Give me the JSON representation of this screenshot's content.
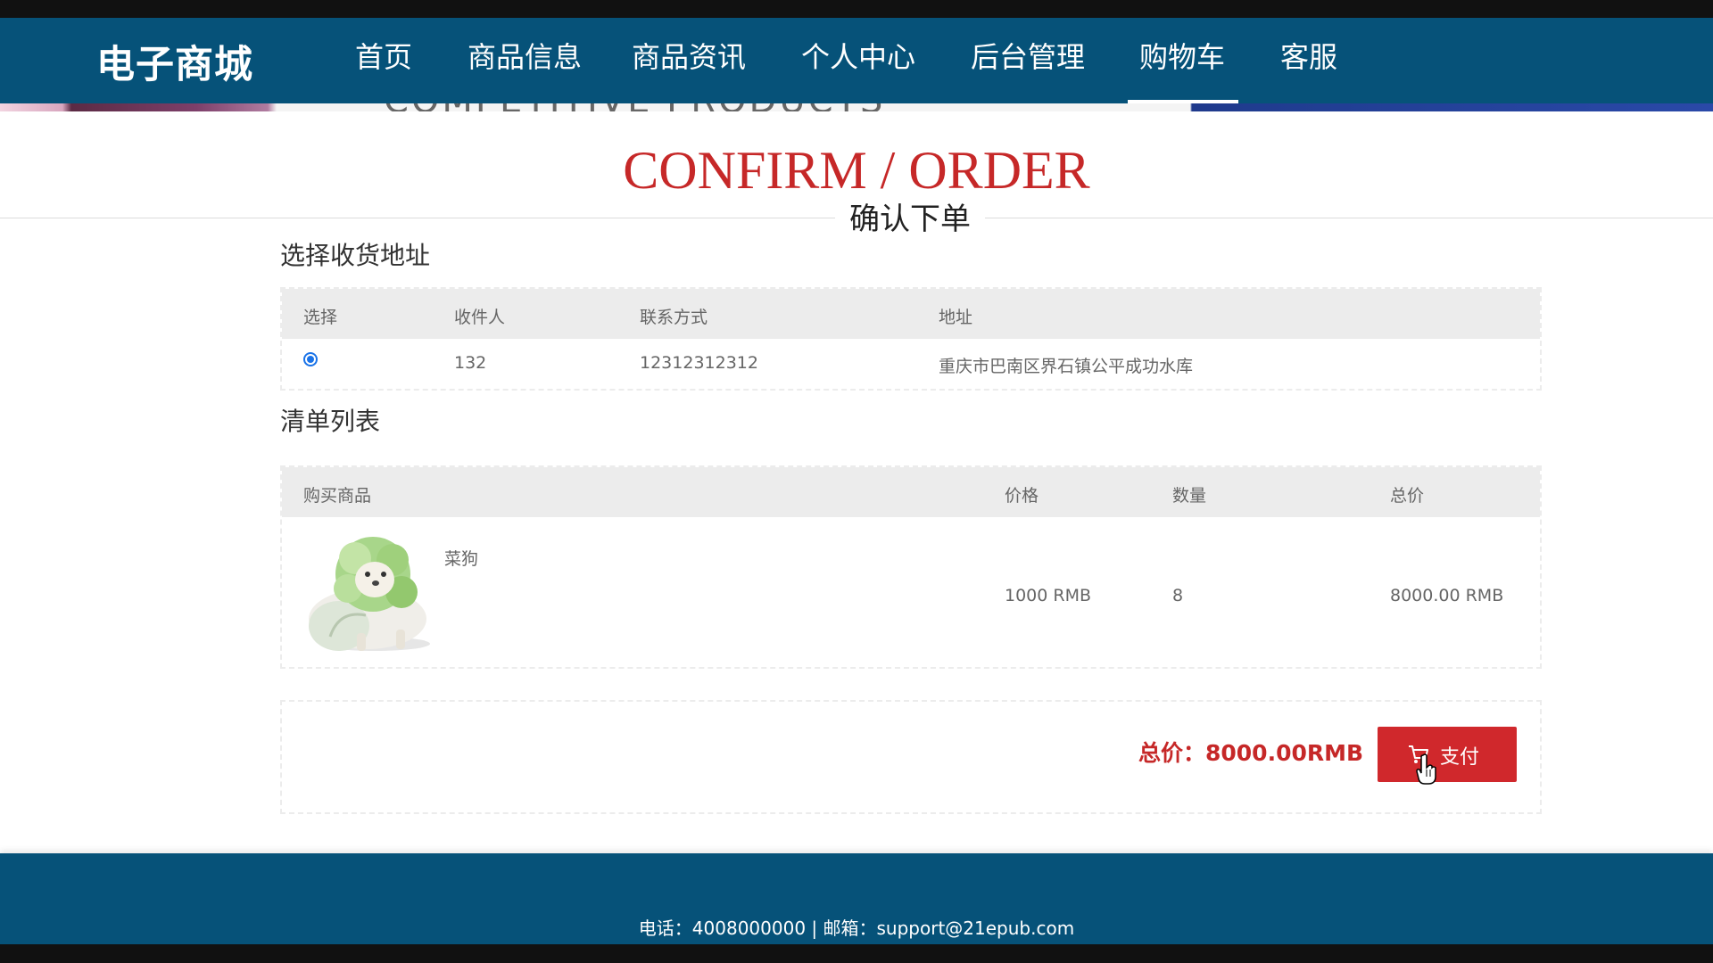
{
  "brand": "电子商城",
  "nav": [
    {
      "label": "首页"
    },
    {
      "label": "商品信息"
    },
    {
      "label": "商品资讯"
    },
    {
      "label": "个人中心"
    },
    {
      "label": "后台管理"
    },
    {
      "label": "购物车",
      "active": true
    },
    {
      "label": "客服"
    }
  ],
  "banner_text": "COMPETITIVE PRODUCTS",
  "page": {
    "title": "CONFIRM / ORDER",
    "subtitle": "确认下单"
  },
  "address_section": {
    "title": "选择收货地址",
    "headers": [
      "选择",
      "收件人",
      "联系方式",
      "地址"
    ],
    "rows": [
      {
        "selected": true,
        "recipient": "132",
        "phone": "12312312312",
        "address": "重庆市巴南区界石镇公平成功水库"
      }
    ]
  },
  "list_section": {
    "title": "清单列表",
    "headers": [
      "购买商品",
      "价格",
      "数量",
      "总价"
    ],
    "items": [
      {
        "name": "菜狗",
        "price": "1000 RMB",
        "quantity": "8",
        "total": "8000.00 RMB",
        "image_icon": "cabbage-dog-image"
      }
    ]
  },
  "summary": {
    "total_label": "总价：8000.00RMB",
    "pay_label": "支付",
    "pay_icon": "cart-icon"
  },
  "footer": {
    "text": "电话：4008000000 | 邮箱：support@21epub.com"
  },
  "colors": {
    "nav_bg": "#065279",
    "accent_red": "#c62828",
    "button_red": "#d0282c",
    "header_gray": "#ececec"
  }
}
